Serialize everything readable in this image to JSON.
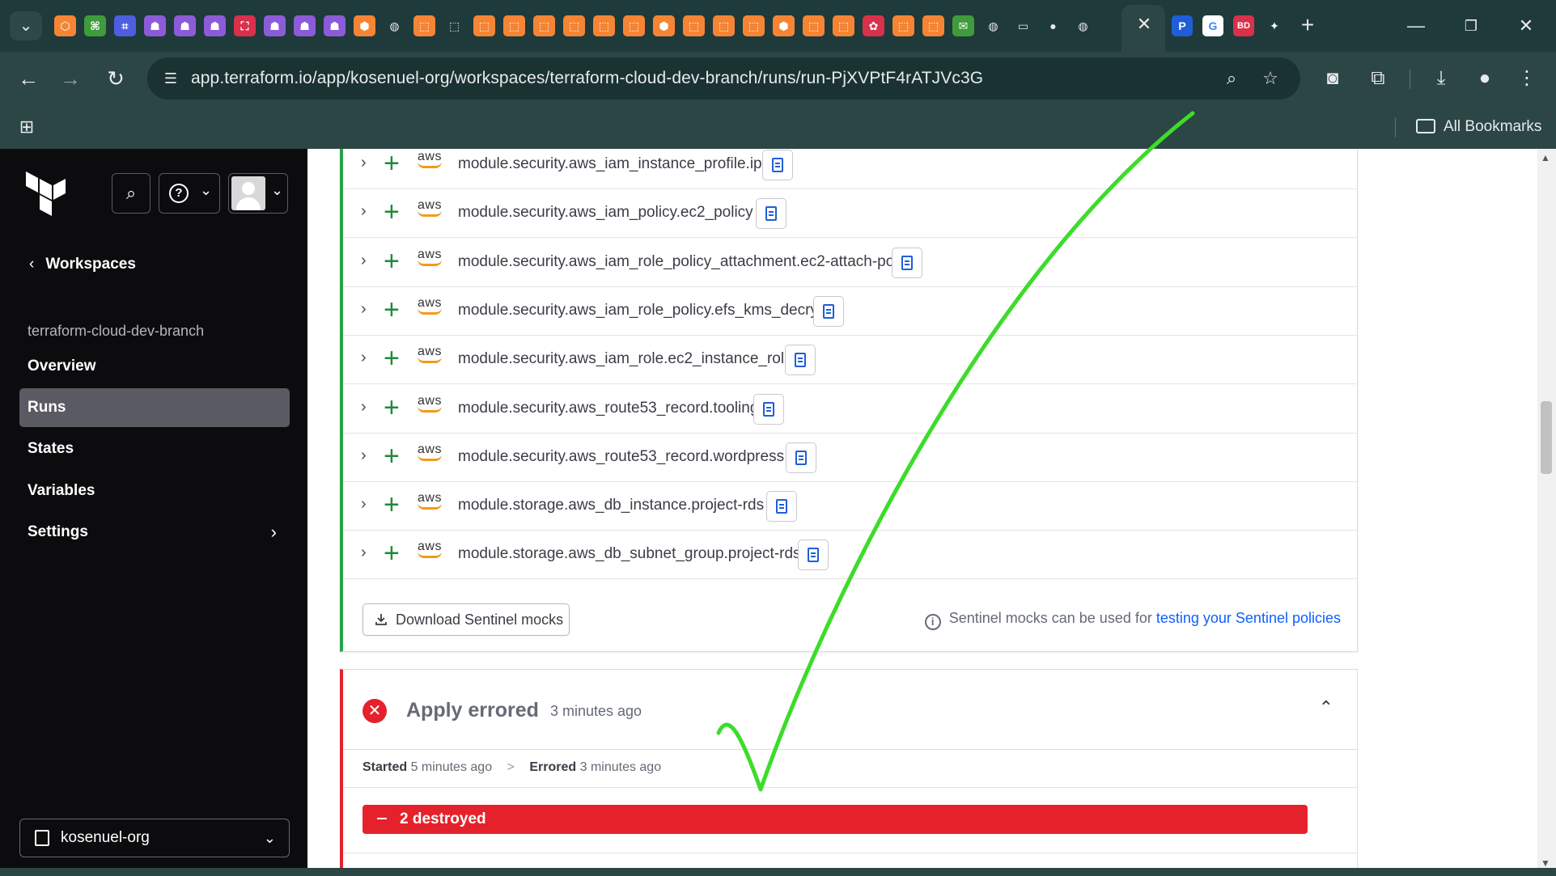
{
  "browser": {
    "tab_menu_icon": "chevron-down-icon",
    "active_tab_close": "✕",
    "new_tab": "+",
    "window_controls": {
      "minimize": "—",
      "restore": "❐",
      "close": "✕"
    },
    "url": "app.terraform.io/app/kosenuel-org/workspaces/terraform-cloud-dev-branch/runs/run-PjXVPtF4rATJVc3G",
    "bookmarks_label": "All Bookmarks",
    "favicon_colors": {
      "orange": "#f58534",
      "green": "#3f9b3c",
      "blue": "#4d5ee0",
      "purple": "#8c5cd8",
      "red": "#d9304c",
      "gray": "#9aa0a6"
    }
  },
  "sidebar": {
    "back_label": "Workspaces",
    "workspace_name": "terraform-cloud-dev-branch",
    "nav": [
      {
        "label": "Overview",
        "active": false
      },
      {
        "label": "Runs",
        "active": true
      },
      {
        "label": "States",
        "active": false
      },
      {
        "label": "Variables",
        "active": false
      },
      {
        "label": "Settings",
        "active": false,
        "has_chevron": true
      }
    ],
    "org_name": "kosenuel-org"
  },
  "plan": {
    "resources": [
      "module.security.aws_iam_instance_profile.ip",
      "module.security.aws_iam_policy.ec2_policy",
      "module.security.aws_iam_role_policy_attachment.ec2-attach-policy",
      "module.security.aws_iam_role_policy.efs_kms_decrypt",
      "module.security.aws_iam_role.ec2_instance_role",
      "module.security.aws_route53_record.tooling",
      "module.security.aws_route53_record.wordpress",
      "module.storage.aws_db_instance.project-rds",
      "module.storage.aws_db_subnet_group.project-rds"
    ],
    "provider_label": "aws",
    "download_button": "Download Sentinel mocks",
    "sentinel_note": "Sentinel mocks can be used for",
    "sentinel_link": "testing your Sentinel policies"
  },
  "apply": {
    "title": "Apply errored",
    "time_ago": "3 minutes ago",
    "started_label": "Started",
    "started_value": "5 minutes ago",
    "timeline_sep": ">",
    "errored_label": "Errored",
    "errored_value": "3 minutes ago",
    "destroyed_summary": "2 destroyed"
  },
  "colors": {
    "create_green": "#1f8a3a",
    "plan_border_green": "#27a24a",
    "error_red": "#e5222b",
    "link_blue": "#1060ff",
    "checkmark_green": "#3ddc2a"
  }
}
